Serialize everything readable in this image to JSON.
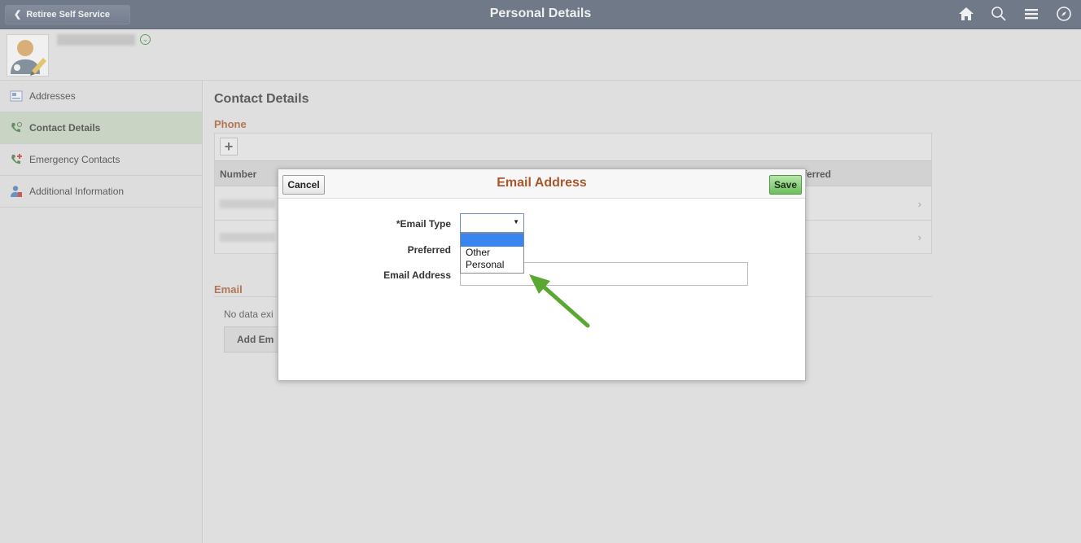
{
  "header": {
    "back_label": "Retiree Self Service",
    "title": "Personal Details",
    "icons": [
      "home-icon",
      "search-icon",
      "menu-icon",
      "navbar-compass-icon"
    ]
  },
  "sidebar": {
    "items": [
      {
        "label": "Addresses",
        "icon": "address-card-icon",
        "active": false
      },
      {
        "label": "Contact Details",
        "icon": "phone-icon",
        "active": true
      },
      {
        "label": "Emergency Contacts",
        "icon": "emergency-phone-icon",
        "active": false
      },
      {
        "label": "Additional Information",
        "icon": "person-info-icon",
        "active": false
      }
    ]
  },
  "main": {
    "title": "Contact Details",
    "phone": {
      "label": "Phone",
      "add_symbol": "+",
      "columns": {
        "number": "Number",
        "preferred": "ferred"
      },
      "row_chevron": "›"
    },
    "email": {
      "label": "Email",
      "no_data_text": "No data exi",
      "add_button_label": "Add Em"
    }
  },
  "modal": {
    "title": "Email Address",
    "cancel_label": "Cancel",
    "save_label": "Save",
    "fields": {
      "email_type_label": "*Email Type",
      "preferred_label": "Preferred",
      "email_address_label": "Email Address"
    },
    "email_type_value": "",
    "email_type_options": [
      "",
      "Other",
      "Personal"
    ],
    "email_address_value": ""
  },
  "colors": {
    "banner": "#4e5a6e",
    "section_accent": "#a9572a",
    "save_green": "#6cbf5c",
    "selection_blue": "#3a86f0",
    "annotation_arrow": "#5aa832"
  }
}
